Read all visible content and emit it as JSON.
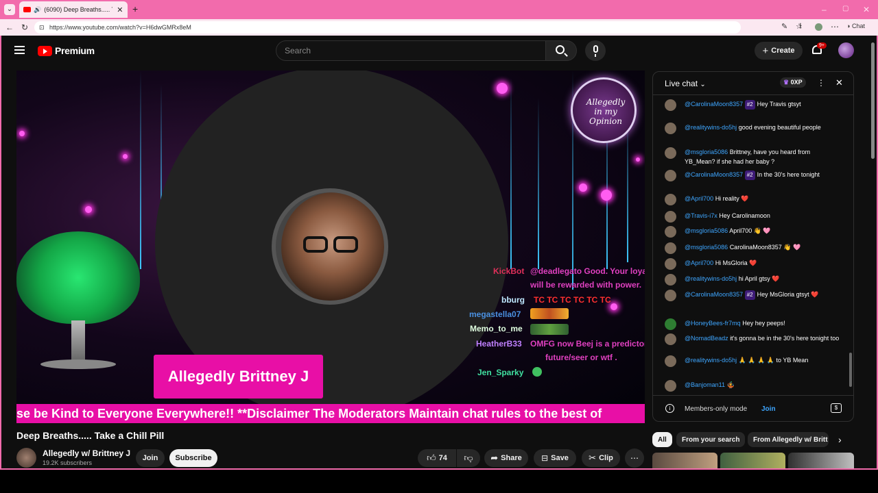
{
  "browser": {
    "tab_title": "(6090) Deep Breaths..... Take a",
    "url": "https://www.youtube.com/watch?v=H6dwGMRx8eM",
    "chat_label": "Chat"
  },
  "header": {
    "brand": "Premium",
    "search_placeholder": "Search",
    "create_label": "Create",
    "notif_count": "9+"
  },
  "video": {
    "nameplate": "Allegedly Brittney J",
    "ticker": "se be Kind to Everyone Everywhere!! **Disclaimer The Moderators Maintain chat rules to the best of",
    "overlay_chat": [
      {
        "name": "KickBot",
        "text": "@deadlegato Good. Your loyalty"
      },
      {
        "name": "",
        "text": "will be rewarded with power."
      },
      {
        "name": "bburg",
        "text": "TC TC TC TC TC TC"
      },
      {
        "name": "megastella07",
        "text": ""
      },
      {
        "name": "Memo_to_me",
        "text": ""
      },
      {
        "name": "HeatherB33",
        "text": "OMFG now Beej is a predictor of"
      },
      {
        "name": "",
        "text": "future/seer or wtf ."
      },
      {
        "name": "Jen_Sparky",
        "text": ""
      }
    ]
  },
  "meta": {
    "title": "Deep Breaths..... Take a Chill Pill",
    "channel": "Allegedly w/ Brittney J",
    "subscribers": "19.2K subscribers",
    "join_label": "Join",
    "subscribe_label": "Subscribe",
    "likes": "74",
    "share_label": "Share",
    "save_label": "Save",
    "clip_label": "Clip"
  },
  "chat": {
    "title": "Live chat",
    "points": "0XP",
    "messages": [
      {
        "user": "@CarolinaMoon8357",
        "rank": "#2",
        "text": "Hey Travis gtsyt"
      },
      {
        "user": "@realitywins-do5hj",
        "rank": "",
        "text": "good evening beautiful people"
      },
      {
        "user": "@msgloria5086",
        "rank": "",
        "text": "Brittney, have you heard from YB_Mean? if she had her baby ?"
      },
      {
        "user": "@CarolinaMoon8357",
        "rank": "#2",
        "text": "In the 30's here tonight"
      },
      {
        "user": "@April700",
        "rank": "",
        "text": "Hi reality ❤️"
      },
      {
        "user": "@Travis-i7x",
        "rank": "",
        "text": "Hey Carolinamoon"
      },
      {
        "user": "@msgloria5086",
        "rank": "",
        "text": "April700 👋 🩷"
      },
      {
        "user": "@msgloria5086",
        "rank": "",
        "text": "CarolinaMoon8357 👋 🩷"
      },
      {
        "user": "@April700",
        "rank": "",
        "text": "Hi MsGloria ❤️"
      },
      {
        "user": "@realitywins-do5hj",
        "rank": "",
        "text": "hi April gtsy ❤️"
      },
      {
        "user": "@CarolinaMoon8357",
        "rank": "#2",
        "text": "Hey MsGloria gtsyt ❤️"
      },
      {
        "user": "@HoneyBees-fr7mq",
        "rank": "",
        "text": "Hey hey peeps!"
      },
      {
        "user": "@NomadBeadz",
        "rank": "",
        "text": "it's gonna be in the 30's here tonight too"
      },
      {
        "user": "@realitywins-do5hj",
        "rank": "",
        "text": "🙏 🙏 🙏 🙏 to YB Mean"
      },
      {
        "user": "@Banjoman11",
        "rank": "",
        "text": "🤹"
      }
    ],
    "members_only": "Members-only mode",
    "join_label": "Join"
  },
  "filters": [
    "All",
    "From your search",
    "From Allegedly w/ Britt"
  ],
  "colors": {
    "accent_pink": "#f26bac",
    "nameplate": "#e80fa6",
    "link_blue": "#3ea6ff"
  }
}
